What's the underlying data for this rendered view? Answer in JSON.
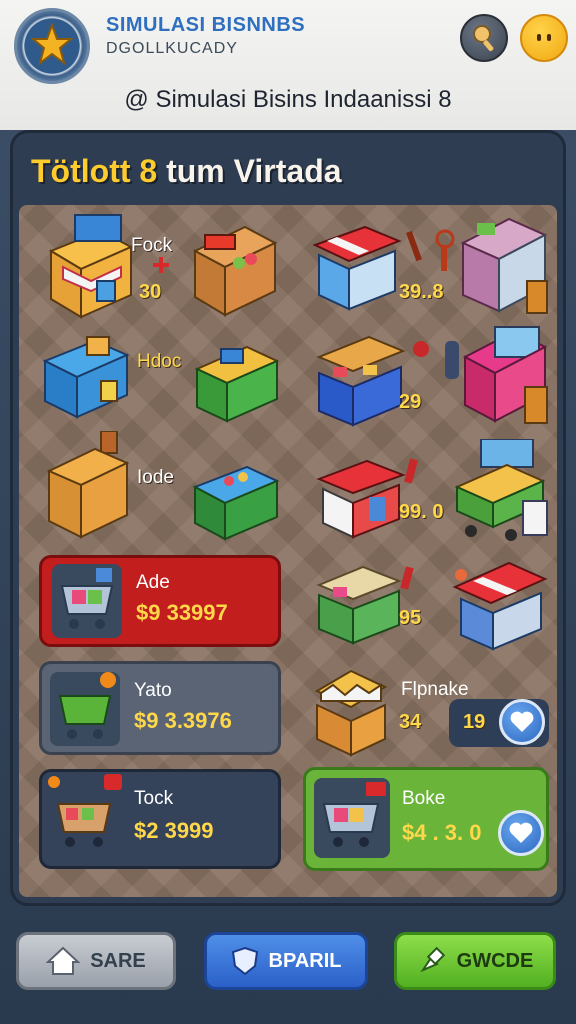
{
  "header": {
    "title": "SIMULASI BISNNBS",
    "subtitle": "DGOLLKUCADY",
    "heading": "Simulasi Bisins Indaanissi 8",
    "heading_prefix": "@"
  },
  "panel": {
    "title_highlight": "Tötlott 8",
    "title_rest": " tum Virtada"
  },
  "left_items": [
    {
      "label": "Fock",
      "price": "30"
    },
    {
      "label": "Hdoc",
      "price": ""
    },
    {
      "label": "Iode",
      "price": ""
    }
  ],
  "right_items": [
    {
      "price": "39..8"
    },
    {
      "price": "29"
    },
    {
      "price": "99. 0"
    },
    {
      "price": "95"
    }
  ],
  "cards": [
    {
      "name": "Ade",
      "price": "$9 33997"
    },
    {
      "name": "Yato",
      "price": "$9 3.3976"
    },
    {
      "name": "Tock",
      "price": "$2 3999"
    }
  ],
  "right_cards": [
    {
      "name": "Flpnake",
      "price": "34",
      "badge": "19"
    },
    {
      "name": "Boke",
      "price": "$4 . 3. 0"
    }
  ],
  "bottom_nav": {
    "home": "SARE",
    "shop": "BPARIL",
    "code": "GWCDE"
  },
  "colors": {
    "header_title": "#2e6fbf",
    "price": "#ffd84a",
    "card_red": "#c62020",
    "card_green": "#68b43a",
    "board": "#8a7363"
  }
}
